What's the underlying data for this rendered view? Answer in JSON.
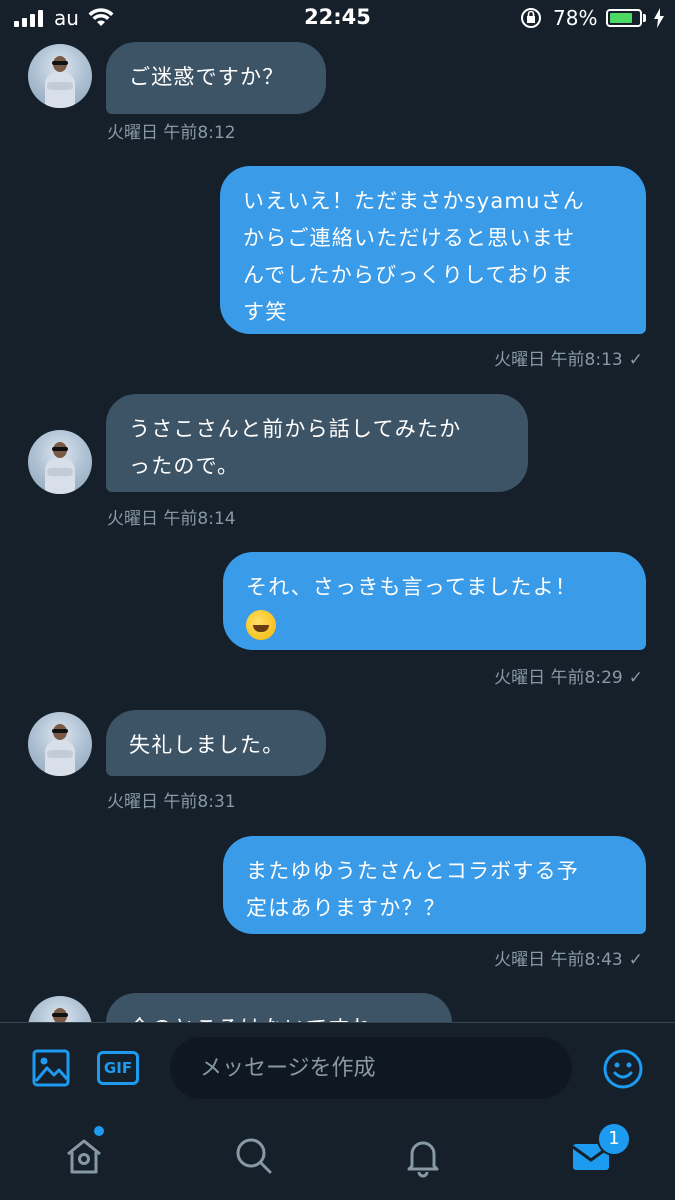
{
  "status_bar": {
    "carrier": "au",
    "time": "22:45",
    "battery_percent": "78%",
    "battery_level": 0.78,
    "icons": [
      "signal-icon",
      "wifi-icon",
      "rotation-lock-icon",
      "battery-icon",
      "charging-icon"
    ]
  },
  "messages": [
    {
      "direction": "in",
      "text": "ご迷惑ですか？",
      "timestamp": "火曜日 午前8:12"
    },
    {
      "direction": "out",
      "text": "いえいえ！ただまさかsyamuさん\nからご連絡いただけると思いませ\nんでしたからびっくりしておりま\nす笑",
      "timestamp": "火曜日 午前8:13",
      "check": "✓"
    },
    {
      "direction": "in",
      "text": "うさこさんと前から話してみたか\nったので。",
      "timestamp": "火曜日 午前8:14"
    },
    {
      "direction": "out",
      "text": "それ、さっきも言ってましたよ！",
      "emoji": "rolling-on-floor-laughing-emoji",
      "timestamp": "火曜日 午前8:29",
      "check": "✓"
    },
    {
      "direction": "in",
      "text": "失礼しました。",
      "timestamp": "火曜日 午前8:31"
    },
    {
      "direction": "out",
      "text": "またゆゆうたさんとコラボする予\n定はありますか？？",
      "timestamp": "火曜日 午前8:43",
      "check": "✓"
    },
    {
      "direction": "in",
      "text": "今のところはないですね。"
    }
  ],
  "composer": {
    "placeholder": "メッセージを作成",
    "gif_label": "GIF"
  },
  "tabbar": {
    "items": [
      "home-icon",
      "search-icon",
      "notifications-icon",
      "messages-icon"
    ],
    "messages_badge": "1"
  },
  "colors": {
    "background": "#15202b",
    "incoming_bubble": "#3d5466",
    "outgoing_bubble": "#3a9be8",
    "accent": "#1d9bf0",
    "meta_text": "#8899a6"
  }
}
